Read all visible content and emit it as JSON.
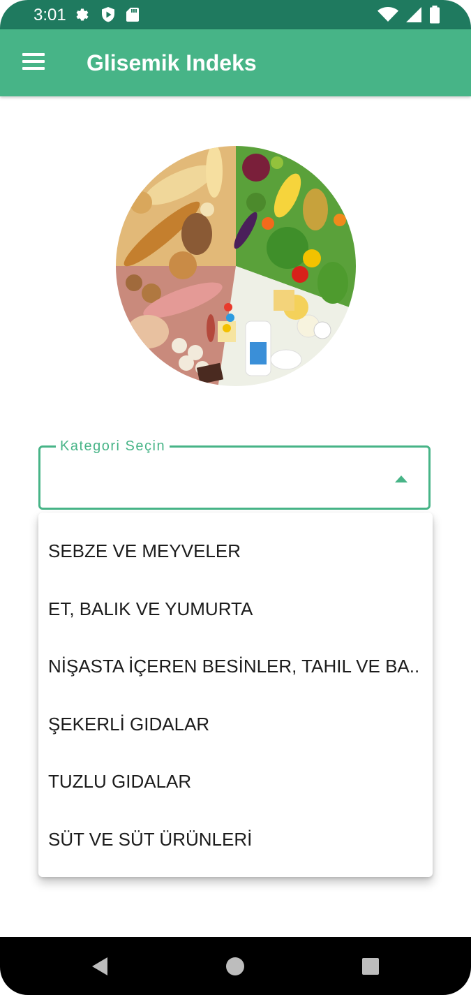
{
  "status_bar": {
    "time": "3:01",
    "icons_left": [
      "settings-icon",
      "shield-play-icon",
      "sd-card-icon"
    ],
    "icons_right": [
      "wifi-icon",
      "signal-icon",
      "battery-icon"
    ]
  },
  "app_bar": {
    "title": "Glisemik Indeks",
    "menu_icon": "hamburger-menu-icon",
    "color": "#47b487"
  },
  "hero_image": {
    "description_icon": "food-groups-plate-image"
  },
  "category_select": {
    "label": "Kategori Seçin",
    "value": "",
    "expanded": true,
    "options": [
      "SEBZE VE MEYVELER",
      "ET, BALIK VE YUMURTA",
      "NİŞASTA İÇEREN BESİNLER, TAHIL VE BA..",
      "ŞEKERLİ GIDALAR",
      "TUZLU GIDALAR",
      "SÜT VE SÜT ÜRÜNLERİ"
    ]
  },
  "nav_bar": {
    "buttons": [
      "back-icon",
      "home-icon",
      "recents-icon"
    ]
  },
  "colors": {
    "accent": "#47b487",
    "status_bar": "#1f7a5f"
  }
}
